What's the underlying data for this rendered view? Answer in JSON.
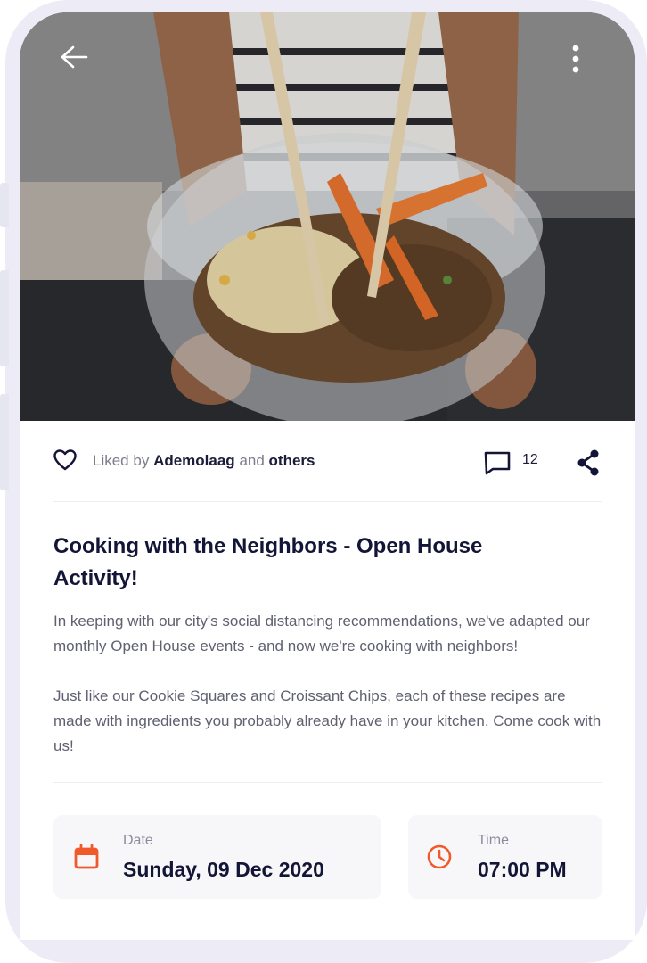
{
  "header": {
    "back_icon": "arrow-left-icon",
    "more_icon": "more-vertical-icon"
  },
  "social": {
    "liked_prefix": "Liked by",
    "liked_user": "Ademolaag",
    "liked_and": "and",
    "liked_others": "others",
    "comment_count": "12",
    "like_icon": "heart-outline-icon",
    "comment_icon": "comment-icon",
    "share_icon": "share-icon"
  },
  "event": {
    "title": "Cooking with the Neighbors - Open House Activity!",
    "description": "In keeping with our city's social distancing recommendations, we've adapted our monthly Open House events - and now we're cooking with neighbors!\n\nJust like our Cookie Squares and Croissant Chips, each of these recipes are made with ingredients you probably already have in your kitchen. Come cook with us!"
  },
  "date_card": {
    "label": "Date",
    "value": "Sunday, 09 Dec 2020",
    "icon": "calendar-icon"
  },
  "time_card": {
    "label": "Time",
    "value": "07:00 PM",
    "icon": "clock-icon"
  },
  "colors": {
    "accent": "#f1592a",
    "title": "#131536",
    "frame": "#ecebf6"
  }
}
